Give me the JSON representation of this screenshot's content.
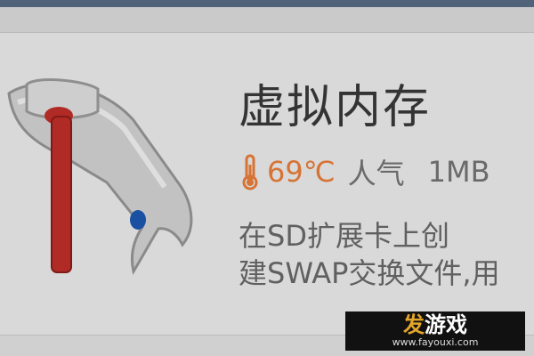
{
  "app": {
    "title": "虚拟内存",
    "temperature": "69℃",
    "popularity_label": "人气",
    "size": "1MB",
    "description_lines": [
      "在SD扩展卡上创",
      "建SWAP交换文件,用"
    ]
  },
  "watermark": {
    "brand_accent": "发",
    "brand_rest": "游戏",
    "url": "www.fayouxi.com"
  },
  "colors": {
    "temperature": "#f0813a",
    "title": "#3a3a3a",
    "secondary_text": "#777777",
    "icon_red": "#c4302b",
    "icon_blue": "#1e5ab4",
    "wm_accent": "#e4a52b"
  },
  "icons": {
    "app_icon": "wrench-and-hammer-icon",
    "meta_icon": "thermometer-icon"
  }
}
